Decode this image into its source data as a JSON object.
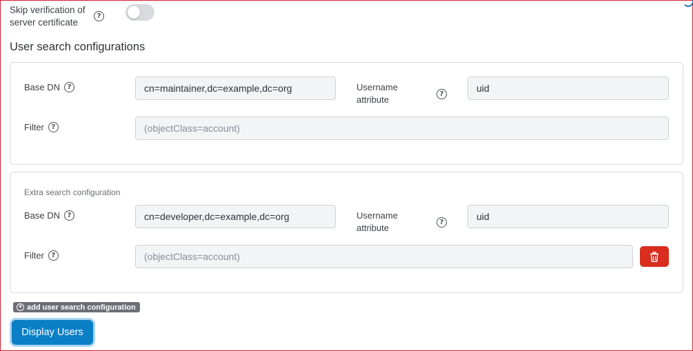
{
  "skip_verification": {
    "label": "Skip verification of server certificate",
    "enabled": false
  },
  "user_search": {
    "title": "User search configurations",
    "primary": {
      "base_dn_label": "Base DN",
      "base_dn_value": "cn=maintainer,dc=example,dc=org",
      "username_attr_label": "Username attribute",
      "username_attr_value": "uid",
      "filter_label": "Filter",
      "filter_placeholder": "(objectClass=account)"
    },
    "extra": {
      "title": "Extra search configuration",
      "base_dn_label": "Base DN",
      "base_dn_value": "cn=developer,dc=example,dc=org",
      "username_attr_label": "Username attribute",
      "username_attr_value": "uid",
      "filter_label": "Filter",
      "filter_placeholder": "(objectClass=account)"
    },
    "add_label": "add user search configuration"
  },
  "actions": {
    "display_users": "Display Users"
  },
  "icons": {
    "help": "?",
    "plus": "+"
  },
  "colors": {
    "primary": "#0a7fc6",
    "danger": "#d92d20",
    "chip": "#6c6f75"
  }
}
